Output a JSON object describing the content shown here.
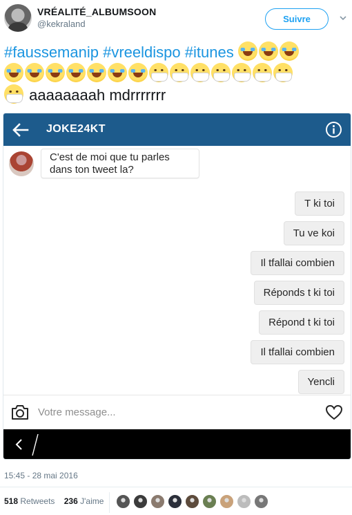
{
  "tweet": {
    "display_name": "VRÉALITÉ_ALBUMSOON",
    "handle": "@kekraland",
    "follow_label": "Suivre",
    "hashtags": [
      "#faussemanip",
      "#vreeldispo",
      "#itunes"
    ],
    "emoji_line1": [
      "joy",
      "joy",
      "joy"
    ],
    "emoji_line2": [
      "joy",
      "joy",
      "joy",
      "joy",
      "joy",
      "joy",
      "joy",
      "mask",
      "mask",
      "mask",
      "mask",
      "mask",
      "mask",
      "mask"
    ],
    "emoji_line3": [
      "mask"
    ],
    "text_tail": "aaaaaaaah mdrrrrrrr"
  },
  "dm": {
    "title": "JOKE24KT",
    "incoming": "C'est de moi que tu parles dans ton tweet la?",
    "outgoing": [
      "T ki toi",
      "Tu ve koi",
      "Il tfallai combien",
      "Réponds t ki toi",
      "Répond t ki toi",
      "Il tfallai combien",
      "Yencli"
    ],
    "input_placeholder": "Votre message...",
    "icons": {
      "back": "arrow-left-icon",
      "info": "info-icon",
      "camera": "camera-icon",
      "like": "heart-icon"
    },
    "colors": {
      "bar": "#1d5b8c",
      "bubble_out": "#efefef"
    }
  },
  "footer": {
    "timestamp": "15:45 - 28 mai 2016",
    "retweets_count": "518",
    "retweets_label": "Retweets",
    "likes_count": "236",
    "likes_label": "J'aime",
    "liker_colors": [
      "#555",
      "#3b3b3b",
      "#8a7a6e",
      "#2b2f3a",
      "#5d4b3c",
      "#6a7f52",
      "#c9a27a",
      "#bcbcbc",
      "#777"
    ]
  },
  "colors": {
    "link": "#1b95e0",
    "follow": "#1da1f2"
  }
}
